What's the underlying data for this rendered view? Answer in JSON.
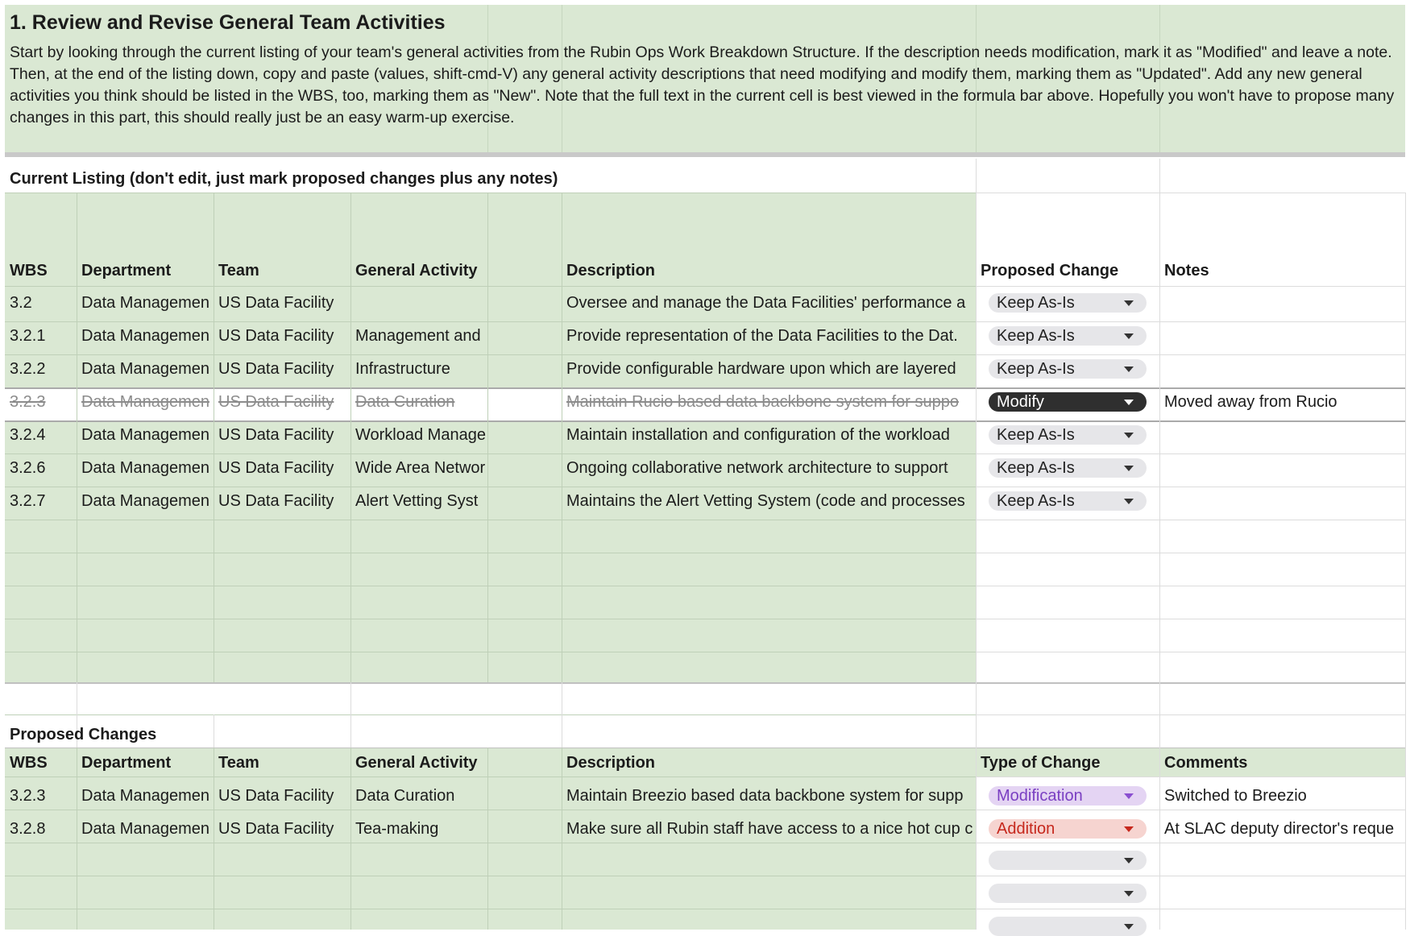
{
  "section": {
    "title": "1. Review and Revise General Team Activities",
    "instructions": "Start by looking through the current listing of your team's general activities from the Rubin Ops Work Breakdown Structure. If the description needs modification, mark it as \"Modified\" and leave a note. Then, at the end of the listing down, copy and paste (values, shift-cmd-V) any general activity descriptions that need modifying and modify them, marking them as \"Updated\".  Add any new general activities you think should be listed in the WBS, too, marking them as \"New\". Note that the full text in the current cell is best viewed in the formula bar above. Hopefully you won't have to propose many changes in this part, this should really just be an easy warm-up exercise."
  },
  "current": {
    "label": "Current Listing (don't edit, just mark proposed changes plus any notes)",
    "headers": {
      "wbs": "WBS",
      "department": "Department",
      "team": "Team",
      "activity": "General Activity",
      "description": "Description",
      "change": "Proposed Change",
      "notes": "Notes"
    },
    "rows": [
      {
        "wbs": "3.2",
        "department": "Data Managemen",
        "team": "US Data Facility",
        "activity": "",
        "description": "Oversee and manage the Data Facilities' performance a",
        "change": "Keep As-Is",
        "notes": ""
      },
      {
        "wbs": "3.2.1",
        "department": "Data Managemen",
        "team": "US Data Facility",
        "activity": "Management and",
        "description": "Provide representation of the Data Facilities to the Dat.",
        "change": "Keep As-Is",
        "notes": ""
      },
      {
        "wbs": "3.2.2",
        "department": "Data Managemen",
        "team": "US Data Facility",
        "activity": "Infrastructure",
        "description": "Provide configurable hardware upon which are layered",
        "change": "Keep As-Is",
        "notes": ""
      },
      {
        "wbs": "3.2.3",
        "department": "Data Managemen",
        "team": "US Data Facility",
        "activity": "Data Curation",
        "description": "Maintain Rucio based data backbone system for suppo",
        "change": "Modify",
        "notes": "Moved away from Rucio"
      },
      {
        "wbs": "3.2.4",
        "department": "Data Managemen",
        "team": "US Data Facility",
        "activity": "Workload Manage",
        "description": "Maintain installation and configuration of the workload",
        "change": "Keep As-Is",
        "notes": ""
      },
      {
        "wbs": "3.2.6",
        "department": "Data Managemen",
        "team": "US Data Facility",
        "activity": "Wide Area Networ",
        "description": "Ongoing collaborative network architecture to support",
        "change": "Keep As-Is",
        "notes": ""
      },
      {
        "wbs": "3.2.7",
        "department": "Data Managemen",
        "team": "US Data Facility",
        "activity": "Alert Vetting Syst",
        "description": "Maintains the Alert Vetting System (code and processes",
        "change": "Keep As-Is",
        "notes": ""
      }
    ]
  },
  "proposed": {
    "label": "Proposed  Changes",
    "headers": {
      "wbs": "WBS",
      "department": "Department",
      "team": "Team",
      "activity": "General Activity",
      "description": "Description",
      "change": "Type of Change",
      "notes": "Comments"
    },
    "rows": [
      {
        "wbs": "3.2.3",
        "department": "Data Managemen",
        "team": "US Data Facility",
        "activity": "Data Curation",
        "description": "Maintain Breezio based data backbone system for supp",
        "change": "Modification",
        "notes": "Switched to Breezio"
      },
      {
        "wbs": "3.2.8",
        "department": "Data Managemen",
        "team": "US Data Facility",
        "activity": "Tea-making",
        "description": "Make sure all Rubin staff have access to a nice hot cup c",
        "change": "Addition",
        "notes": "At SLAC deputy director's reque"
      }
    ],
    "empty_dropdowns": 3
  },
  "colors": {
    "green_fill": "#dae8d3",
    "modify_pill": "#2f2f2f",
    "modification_pill": "#e4d4f3",
    "addition_pill": "#f6d4d0",
    "keep_pill": "#e6e6e9"
  }
}
